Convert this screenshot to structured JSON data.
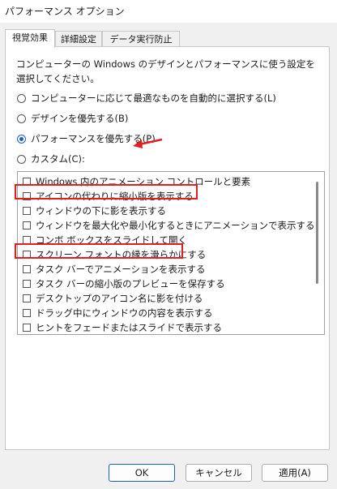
{
  "window": {
    "title": "パフォーマンス オプション"
  },
  "tabs": [
    {
      "label": "視覚効果",
      "active": true
    },
    {
      "label": "詳細設定",
      "active": false
    },
    {
      "label": "データ実行防止",
      "active": false
    }
  ],
  "description": "コンピューターの Windows のデザインとパフォーマンスに使う設定を選択してください。",
  "radios": [
    {
      "label": "コンピューターに応じて最適なものを自動的に選択する(L)",
      "checked": false
    },
    {
      "label": "デザインを優先する(B)",
      "checked": false
    },
    {
      "label": "パフォーマンスを優先する(P)",
      "checked": true
    },
    {
      "label": "カスタム(C):",
      "checked": false
    }
  ],
  "effects": [
    {
      "label": "Windows 内のアニメーション コントロールと要素",
      "checked": false
    },
    {
      "label": "アイコンの代わりに縮小版を表示する",
      "checked": false
    },
    {
      "label": "ウィンドウの下に影を表示する",
      "checked": false
    },
    {
      "label": "ウィンドウを最大化や最小化するときにアニメーションで表示する",
      "checked": false
    },
    {
      "label": "コンボ ボックスをスライドして開く",
      "checked": false
    },
    {
      "label": "スクリーン フォントの縁を滑らかにする",
      "checked": false
    },
    {
      "label": "タスク バーでアニメーションを表示する",
      "checked": false
    },
    {
      "label": "タスク バーの縮小版のプレビューを保存する",
      "checked": false
    },
    {
      "label": "デスクトップのアイコン名に影を付ける",
      "checked": false
    },
    {
      "label": "ドラッグ中にウィンドウの内容を表示する",
      "checked": false
    },
    {
      "label": "ヒントをフェードまたはスライドで表示する",
      "checked": false
    }
  ],
  "annotations": {
    "highlight_color": "#e02020"
  },
  "buttons": {
    "ok": "OK",
    "cancel": "キャンセル",
    "apply": "適用(A)"
  },
  "colors": {
    "accent": "#1d5fbf",
    "panel": "#ffffff",
    "window": "#f0f0f0"
  }
}
